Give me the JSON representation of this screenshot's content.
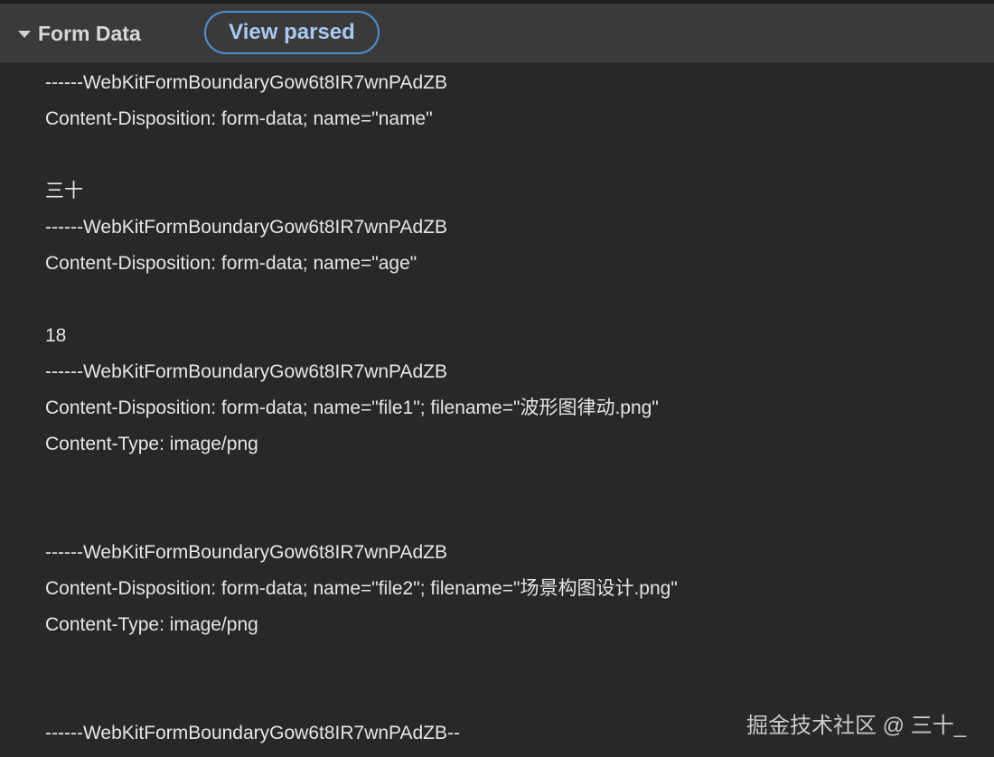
{
  "section": {
    "title": "Form Data",
    "view_button": "View parsed"
  },
  "form_data_lines": [
    "------WebKitFormBoundaryGow6t8IR7wnPAdZB",
    "Content-Disposition: form-data; name=\"name\"",
    "",
    "三十",
    "------WebKitFormBoundaryGow6t8IR7wnPAdZB",
    "Content-Disposition: form-data; name=\"age\"",
    "",
    "18",
    "------WebKitFormBoundaryGow6t8IR7wnPAdZB",
    "Content-Disposition: form-data; name=\"file1\"; filename=\"波形图律动.png\"",
    "Content-Type: image/png",
    "",
    "",
    "------WebKitFormBoundaryGow6t8IR7wnPAdZB",
    "Content-Disposition: form-data; name=\"file2\"; filename=\"场景构图设计.png\"",
    "Content-Type: image/png",
    "",
    "",
    "------WebKitFormBoundaryGow6t8IR7wnPAdZB--"
  ],
  "watermark": "掘金技术社区 @ 三十_"
}
